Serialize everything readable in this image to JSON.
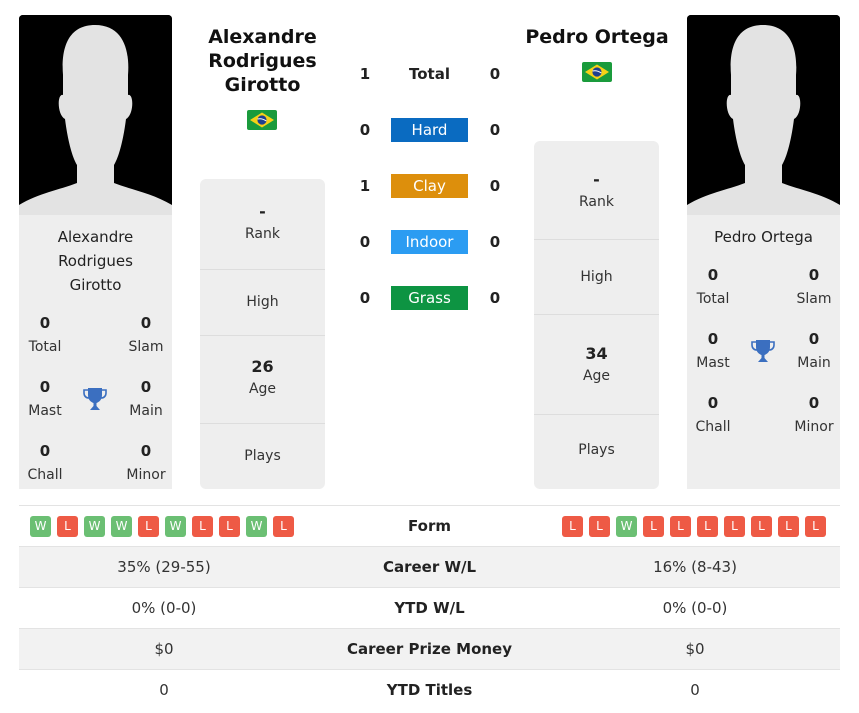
{
  "players": [
    {
      "full_name": "Alexandre Rodrigues Girotto",
      "name_lines": [
        "Alexandre",
        "Rodrigues",
        "Girotto"
      ],
      "country": "Brazil",
      "flag_icon": "brazil-flag-icon",
      "titles": {
        "total": {
          "label": "Total",
          "value": "0"
        },
        "slam": {
          "label": "Slam",
          "value": "0"
        },
        "mast": {
          "label": "Mast",
          "value": "0"
        },
        "main": {
          "label": "Main",
          "value": "0"
        },
        "chall": {
          "label": "Chall",
          "value": "0"
        },
        "minor": {
          "label": "Minor",
          "value": "0"
        }
      },
      "stats": {
        "rank": {
          "label": "Rank",
          "value": "-"
        },
        "high": {
          "label": "High",
          "value": ""
        },
        "age": {
          "label": "Age",
          "value": "26"
        },
        "plays": {
          "label": "Plays",
          "value": ""
        }
      },
      "form": [
        "W",
        "L",
        "W",
        "W",
        "L",
        "W",
        "L",
        "L",
        "W",
        "L"
      ],
      "career_wl": "35% (29-55)",
      "ytd_wl": "0% (0-0)",
      "prize_money": "$0",
      "ytd_titles": "0"
    },
    {
      "full_name": "Pedro Ortega",
      "name_lines": [
        "Pedro Ortega"
      ],
      "country": "Brazil",
      "flag_icon": "brazil-flag-icon",
      "titles": {
        "total": {
          "label": "Total",
          "value": "0"
        },
        "slam": {
          "label": "Slam",
          "value": "0"
        },
        "mast": {
          "label": "Mast",
          "value": "0"
        },
        "main": {
          "label": "Main",
          "value": "0"
        },
        "chall": {
          "label": "Chall",
          "value": "0"
        },
        "minor": {
          "label": "Minor",
          "value": "0"
        }
      },
      "stats": {
        "rank": {
          "label": "Rank",
          "value": "-"
        },
        "high": {
          "label": "High",
          "value": ""
        },
        "age": {
          "label": "Age",
          "value": "34"
        },
        "plays": {
          "label": "Plays",
          "value": ""
        }
      },
      "form": [
        "L",
        "L",
        "W",
        "L",
        "L",
        "L",
        "L",
        "L",
        "L",
        "L"
      ],
      "career_wl": "16% (8-43)",
      "ytd_wl": "0% (0-0)",
      "prize_money": "$0",
      "ytd_titles": "0"
    }
  ],
  "h2h": [
    {
      "label": "Total",
      "left": "1",
      "right": "0",
      "color": null
    },
    {
      "label": "Hard",
      "left": "0",
      "right": "0",
      "color": "#0a6bc1"
    },
    {
      "label": "Clay",
      "left": "1",
      "right": "0",
      "color": "#dd8f0c"
    },
    {
      "label": "Indoor",
      "left": "0",
      "right": "0",
      "color": "#2b9cf2"
    },
    {
      "label": "Grass",
      "left": "0",
      "right": "0",
      "color": "#0d9442"
    }
  ],
  "comparison_labels": {
    "form": "Form",
    "career_wl": "Career W/L",
    "ytd_wl": "YTD W/L",
    "prize_money": "Career Prize Money",
    "ytd_titles": "YTD Titles"
  },
  "colors": {
    "win": "#6bbf73",
    "loss": "#ee5a45",
    "trophy": "#3b6fc0"
  }
}
